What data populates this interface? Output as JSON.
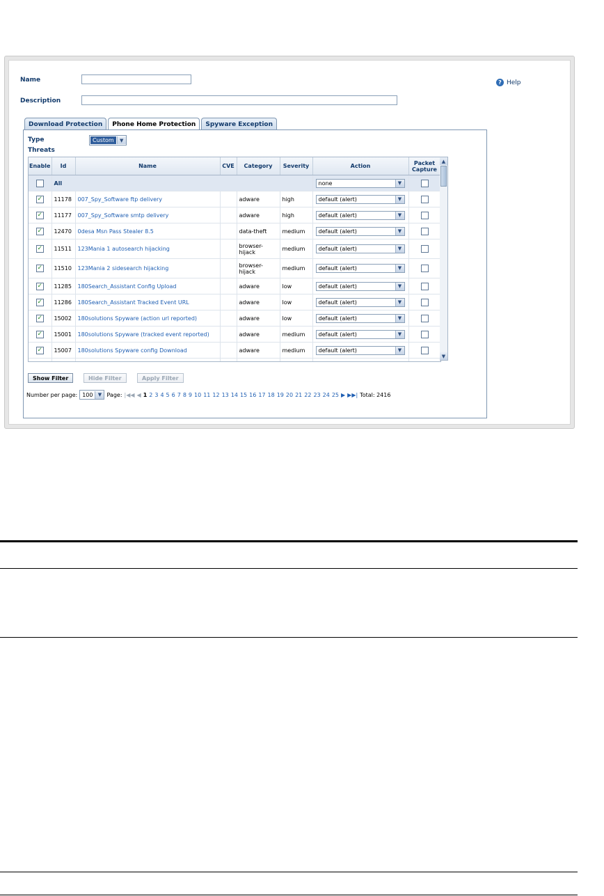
{
  "form": {
    "name_label": "Name",
    "name_value": "",
    "description_label": "Description",
    "description_value": "",
    "help_label": "Help"
  },
  "tabs": [
    {
      "label": "Download Protection"
    },
    {
      "label": "Phone Home Protection"
    },
    {
      "label": "Spyware Exception"
    }
  ],
  "active_tab": "Phone Home Protection",
  "type": {
    "label": "Type",
    "value": "Custom"
  },
  "threats_label": "Threats",
  "table": {
    "headers": [
      "Enable",
      "Id",
      "Name",
      "CVE",
      "Category",
      "Severity",
      "Action",
      "Packet Capture"
    ],
    "all_row": {
      "label": "All",
      "action": "none",
      "enabled": false,
      "capture": false
    },
    "rows": [
      {
        "id": "11178",
        "name": "007_Spy_Software ftp delivery",
        "cve": "",
        "category": "adware",
        "severity": "high",
        "action": "default (alert)",
        "enabled": true,
        "capture": false
      },
      {
        "id": "11177",
        "name": "007_Spy_Software smtp delivery",
        "cve": "",
        "category": "adware",
        "severity": "high",
        "action": "default (alert)",
        "enabled": true,
        "capture": false
      },
      {
        "id": "12470",
        "name": "0desa Msn Pass Stealer 8.5",
        "cve": "",
        "category": "data-theft",
        "severity": "medium",
        "action": "default (alert)",
        "enabled": true,
        "capture": false
      },
      {
        "id": "11511",
        "name": "123Mania 1 autosearch hijacking",
        "cve": "",
        "category": "browser-hijack",
        "severity": "medium",
        "action": "default (alert)",
        "enabled": true,
        "capture": false
      },
      {
        "id": "11510",
        "name": "123Mania 2 sidesearch hijacking",
        "cve": "",
        "category": "browser-hijack",
        "severity": "medium",
        "action": "default (alert)",
        "enabled": true,
        "capture": false
      },
      {
        "id": "11285",
        "name": "180Search_Assistant Config Upload",
        "cve": "",
        "category": "adware",
        "severity": "low",
        "action": "default (alert)",
        "enabled": true,
        "capture": false
      },
      {
        "id": "11286",
        "name": "180Search_Assistant Tracked Event URL",
        "cve": "",
        "category": "adware",
        "severity": "low",
        "action": "default (alert)",
        "enabled": true,
        "capture": false
      },
      {
        "id": "15002",
        "name": "180solutions Spyware (action url reported)",
        "cve": "",
        "category": "adware",
        "severity": "low",
        "action": "default (alert)",
        "enabled": true,
        "capture": false
      },
      {
        "id": "15001",
        "name": "180solutions Spyware (tracked event reported)",
        "cve": "",
        "category": "adware",
        "severity": "medium",
        "action": "default (alert)",
        "enabled": true,
        "capture": false
      },
      {
        "id": "15007",
        "name": "180solutions Spyware config Download",
        "cve": "",
        "category": "adware",
        "severity": "medium",
        "action": "default (alert)",
        "enabled": true,
        "capture": false
      }
    ]
  },
  "buttons": {
    "show_filter": "Show Filter",
    "hide_filter": "Hide Filter",
    "apply_filter": "Apply Filter"
  },
  "pager": {
    "per_page_label": "Number per page:",
    "per_page_value": "100",
    "page_label": "Page:",
    "current_page": "1",
    "pages": [
      "1",
      "2",
      "3",
      "4",
      "5",
      "6",
      "7",
      "8",
      "9",
      "10",
      "11",
      "12",
      "13",
      "14",
      "15",
      "16",
      "17",
      "18",
      "19",
      "20",
      "21",
      "22",
      "23",
      "24",
      "25"
    ],
    "total_label": "Total: 2416"
  }
}
